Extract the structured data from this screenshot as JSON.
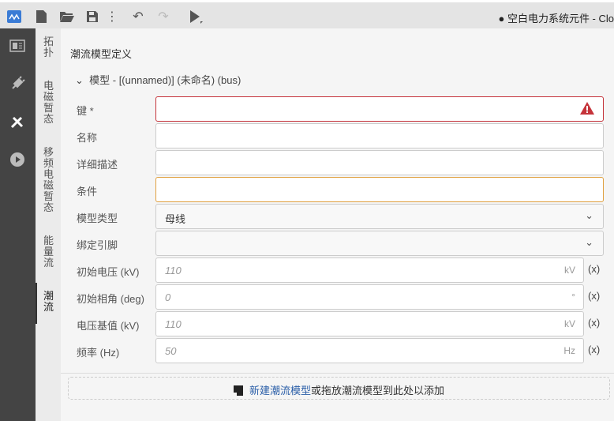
{
  "window": {
    "title": "空白电力系统元件 - Clo",
    "modified_dot": "●"
  },
  "toolbar": [
    "app-logo",
    "new-file",
    "open-folder",
    "save",
    "more",
    "undo",
    "redo",
    "run"
  ],
  "vertical_tabs": [
    {
      "label": "拓扑"
    },
    {
      "label": "电磁暂态"
    },
    {
      "label": "移频电磁暂态"
    },
    {
      "label": "能量流"
    },
    {
      "label": "潮流",
      "active": true
    }
  ],
  "main": {
    "heading": "潮流模型定义",
    "section": "模型 - [(unnamed)]  (未命名)  (bus)",
    "fields": [
      {
        "label": "键 *",
        "value": ""
      },
      {
        "label": "名称",
        "value": ""
      },
      {
        "label": "详细描述",
        "value": ""
      },
      {
        "label": "条件",
        "value": ""
      },
      {
        "label": "模型类型",
        "value": "母线"
      },
      {
        "label": "绑定引脚",
        "value": ""
      },
      {
        "label": "初始电压 (kV)",
        "value": "110",
        "unit": "kV",
        "expr": "(x)"
      },
      {
        "label": "初始相角 (deg)",
        "value": "0",
        "unit": "°",
        "expr": "(x)"
      },
      {
        "label": "电压基值 (kV)",
        "value": "110",
        "unit": "kV",
        "expr": "(x)"
      },
      {
        "label": "频率 (Hz)",
        "value": "50",
        "unit": "Hz",
        "expr": "(x)"
      }
    ],
    "drop": {
      "link": "新建潮流模型",
      "text": "或拖放潮流模型到此处以添加"
    }
  },
  "colors": {
    "error": "#c5333a",
    "warn": "#e0a040",
    "link": "#2a5ea8"
  }
}
